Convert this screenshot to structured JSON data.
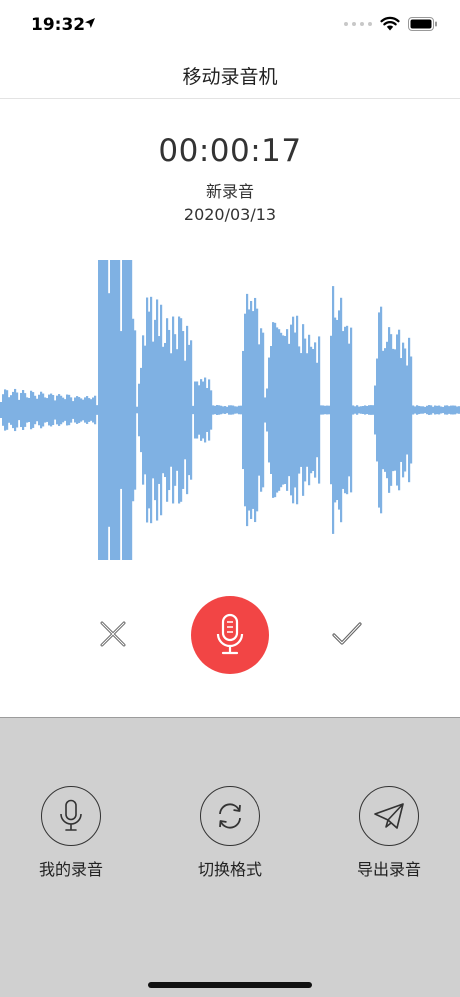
{
  "status_bar": {
    "time": "19:32",
    "icons": [
      "location-arrow-icon",
      "cellular-signal-icon",
      "wifi-icon",
      "battery-icon"
    ]
  },
  "nav": {
    "title": "移动录音机"
  },
  "recording": {
    "elapsed": "00:00:17",
    "name": "新录音",
    "date": "2020/03/13"
  },
  "waveform": {
    "color": "#7fb1e3",
    "icon": "audio-waveform"
  },
  "controls": {
    "discard_icon": "close-x-icon",
    "record_icon": "microphone-icon",
    "record_color": "#f24545",
    "confirm_icon": "checkmark-icon"
  },
  "bottom_actions": [
    {
      "label": "我的录音",
      "icon": "microphone-icon"
    },
    {
      "label": "切换格式",
      "icon": "refresh-cycle-icon"
    },
    {
      "label": "导出录音",
      "icon": "paper-plane-icon"
    }
  ],
  "colors": {
    "panel_background": "#d0d0d0",
    "accent_red": "#f24545",
    "wave_blue": "#7fb1e3"
  }
}
